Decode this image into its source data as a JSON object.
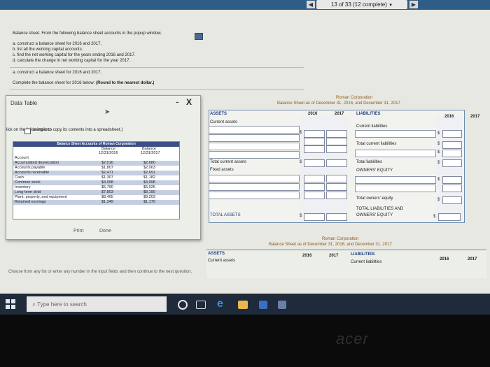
{
  "topbar": {
    "counter": "13 of 33 (12 complete)",
    "prev_icon": "◀",
    "next_icon": "▶",
    "dropdown_icon": "▼"
  },
  "question": {
    "intro": "Balance sheet. From the following balance sheet accounts in the popup window,",
    "tasks": [
      "a. construct a balance sheet for 2016 and 2017.",
      "b. list all the working capital accounts.",
      "c. find the net working capital for the years ending 2016 and 2017.",
      "d. calculate the change in net working capital for the year 2017."
    ],
    "part_a": "a. construct a balance sheet for 2016 and 2017.",
    "instruction": "Complete the balance sheet for 2016 below:",
    "instruction_note": "(Round to the nearest dollar.)"
  },
  "popup": {
    "title": "Data Table",
    "minimize": "-",
    "close": "X",
    "copy_text_1": "lick on the following icon",
    "copy_text_2": "in order to copy its contents into a spreadsheet.)",
    "table_title": "Balance Sheet Accounts of Roman Corporation",
    "col1_header": [
      "Balance",
      "12/31/2016"
    ],
    "col2_header": [
      "Balance",
      "12/31/2017"
    ],
    "rows": [
      {
        "label": "Account",
        "v2016": "",
        "v2017": ""
      },
      {
        "label": "Accumulated depreciation",
        "v2016": "$2,016",
        "v2017": "$2,680"
      },
      {
        "label": "Accounts payable",
        "v2016": "$1,807",
        "v2017": "$2,063"
      },
      {
        "label": "Accounts receivable",
        "v2016": "$2,471",
        "v2017": "$2,691"
      },
      {
        "label": "Cash",
        "v2016": "$1,307",
        "v2017": "$1,182"
      },
      {
        "label": "Common stock",
        "v2016": "$4,998",
        "v2017": "$4,998"
      },
      {
        "label": "Inventory",
        "v2016": "$5,790",
        "v2017": "$6,025"
      },
      {
        "label": "Long-term debt",
        "v2016": "$7,803",
        "v2017": "$8,190"
      },
      {
        "label": "Plant, property, and equipment",
        "v2016": "$8,405",
        "v2017": "$9,203"
      },
      {
        "label": "Retained earnings",
        "v2016": "$1,349",
        "v2017": "$1,170"
      }
    ],
    "print": "Print",
    "done": "Done"
  },
  "sheet": {
    "company": "Roman Corporation",
    "subtitle": "Balance Sheet as of December 31, 2016, and December 31, 2017",
    "assets_header": "ASSETS",
    "year_2016": "2016",
    "year_2017": "2017",
    "liabilities_header": "LIABILITIES",
    "current_assets": "Current assets",
    "current_liabilities": "Current liabilities",
    "total_current_liabilities": "Total current liabilities",
    "total_current_assets": "Total current assets",
    "fixed_assets": "Fixed assets",
    "total_liabilities": "Total liabilities",
    "owners_equity": "OWNERS' EQUITY",
    "total_owners_equity": "Total owners' equity",
    "total_liab_equity_1": "TOTAL LIABILITIES AND",
    "total_liab_equity_2": "OWNERS' EQUITY",
    "total_assets": "TOTAL ASSETS",
    "dollar": "$"
  },
  "sheet2": {
    "company": "Roman Corporation",
    "subtitle": "Balance Sheet as of December 31, 2016, and December 31, 2017",
    "assets_header": "ASSETS",
    "year_2016": "2016",
    "year_2017": "2017",
    "liabilities_header": "LIABILITIES",
    "current_assets": "Current assets",
    "current_liabilities": "Current liabilities"
  },
  "footer_hint": "Choose from any list or enter any number in the input fields and then continue to the next question.",
  "taskbar": {
    "search_placeholder": "Type here to search"
  },
  "brand": "acer"
}
